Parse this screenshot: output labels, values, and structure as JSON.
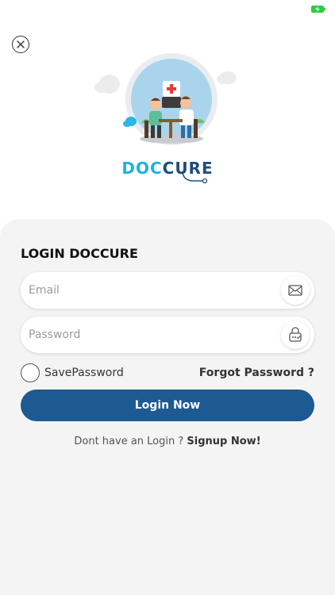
{
  "brand": {
    "part1": "DOC",
    "part2": "CURE"
  },
  "login": {
    "title": "LOGIN DOCCURE",
    "email_placeholder": "Email",
    "password_placeholder": "Password",
    "save_password_label": "SavePassword",
    "forgot_password_label": "Forgot Password ?",
    "login_button_label": "Login Now",
    "signup_prompt": "Dont have an Login ?",
    "signup_link": "Signup Now!"
  },
  "colors": {
    "primary": "#1d5a92",
    "brand_light": "#1fb3df",
    "card_bg": "#f4f4f4",
    "battery": "#2ecc40"
  }
}
